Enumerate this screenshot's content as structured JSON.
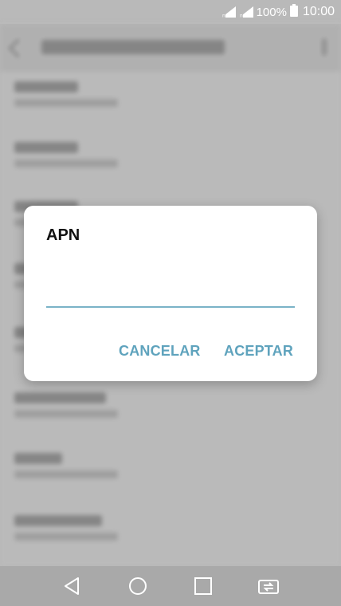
{
  "status_bar": {
    "battery": "100%",
    "time": "10:00"
  },
  "dialog": {
    "title": "APN",
    "input_value": "",
    "cancel_label": "CANCELAR",
    "ok_label": "ACEPTAR"
  },
  "nav_bar": {
    "icons": [
      "back-icon",
      "home-icon",
      "recents-icon",
      "dual-window-icon"
    ]
  },
  "colors": {
    "accent": "#5fa3bd",
    "input_line": "#7ab3c7",
    "dialog_bg": "#ffffff"
  }
}
